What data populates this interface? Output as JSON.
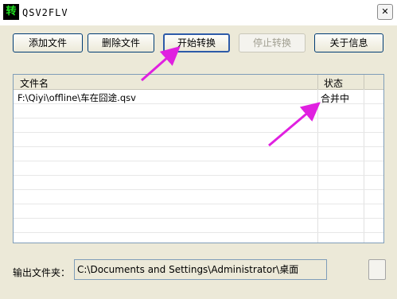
{
  "window": {
    "title": "QSV2FLV",
    "icon_glyph": "转",
    "icon": "app-icon",
    "close_glyph": "✕"
  },
  "toolbar": {
    "add_label": "添加文件",
    "delete_label": "删除文件",
    "start_label": "开始转换",
    "stop_label": "停止转换",
    "about_label": "关于信息"
  },
  "file_list": {
    "columns": [
      "文件名",
      "状态"
    ],
    "rows": [
      {
        "file": "F:\\Qiyi\\offline\\车在囧途.qsv",
        "status": "合并中"
      }
    ]
  },
  "output": {
    "label": "输出文件夹：",
    "path": "C:\\Documents and Settings\\Administrator\\桌面"
  },
  "colors": {
    "annotation_arrow": "#e020e0",
    "window_background": "#ece9d8"
  }
}
